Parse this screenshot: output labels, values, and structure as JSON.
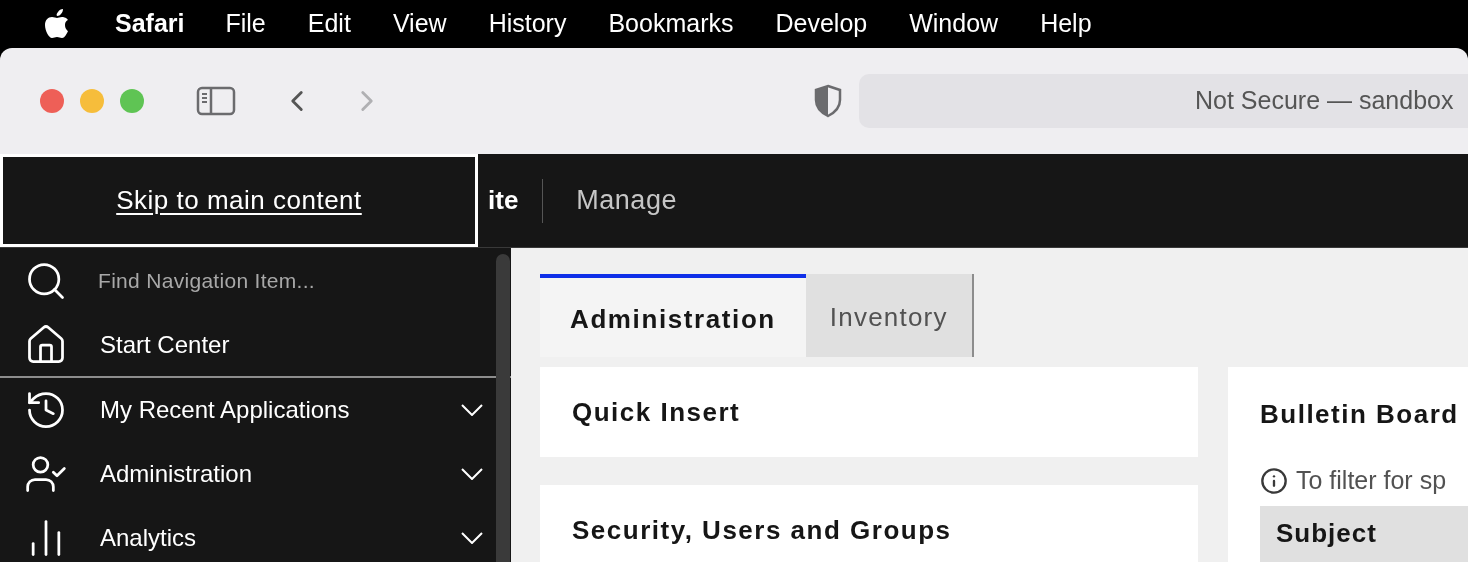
{
  "menu_bar": {
    "app": "Safari",
    "items": [
      "File",
      "Edit",
      "View",
      "History",
      "Bookmarks",
      "Develop",
      "Window",
      "Help"
    ]
  },
  "toolbar": {
    "address": "Not Secure — sandbox"
  },
  "header": {
    "title_fragment": "ite",
    "nav": "Manage"
  },
  "skip_link": "Skip to main content",
  "sidebar": {
    "search_placeholder": "Find Navigation Item...",
    "items": [
      {
        "label": "Start Center",
        "kind": "link"
      },
      {
        "label": "My Recent Applications",
        "kind": "group",
        "expanded": false
      },
      {
        "label": "Administration",
        "kind": "group",
        "expanded": false
      },
      {
        "label": "Analytics",
        "kind": "group",
        "expanded": false
      }
    ]
  },
  "tabs": [
    {
      "label": "Administration",
      "selected": true
    },
    {
      "label": "Inventory",
      "selected": false
    }
  ],
  "left_cards": [
    {
      "title": "Quick Insert"
    },
    {
      "title": "Security, Users and Groups"
    }
  ],
  "bulletin": {
    "title": "Bulletin Board",
    "hint": "To filter for sp",
    "column": "Subject"
  }
}
